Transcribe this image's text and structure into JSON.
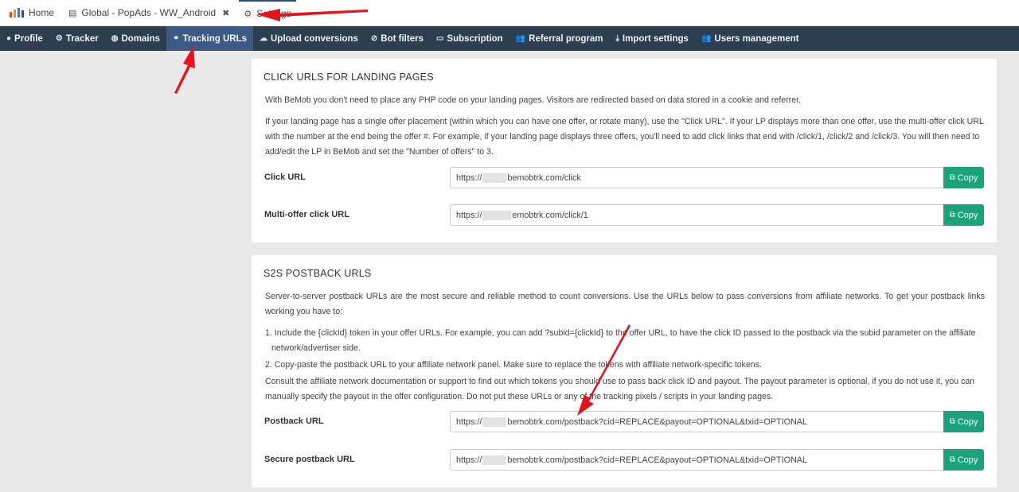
{
  "topbar": {
    "tabs": [
      {
        "label": "Home"
      },
      {
        "label": "Global - PopAds - WW_Android"
      },
      {
        "label": "Settings"
      }
    ]
  },
  "nav": {
    "items": [
      {
        "label": "Profile",
        "icon": "user-icon"
      },
      {
        "label": "Tracker",
        "icon": "gear-icon"
      },
      {
        "label": "Domains",
        "icon": "globe-icon"
      },
      {
        "label": "Tracking URLs",
        "icon": "link-icon",
        "active": true
      },
      {
        "label": "Upload conversions",
        "icon": "cloud-upload-icon"
      },
      {
        "label": "Bot filters",
        "icon": "ban-icon"
      },
      {
        "label": "Subscription",
        "icon": "card-icon"
      },
      {
        "label": "Referral program",
        "icon": "users-icon"
      },
      {
        "label": "Import settings",
        "icon": "download-icon"
      },
      {
        "label": "Users management",
        "icon": "users-icon"
      }
    ]
  },
  "click_panel": {
    "title": "CLICK URLS FOR LANDING PAGES",
    "p1": "With BeMob you don't need to place any PHP code on your landing pages. Visitors are redirected based on data stored in a cookie and referrer.",
    "p2": "If your landing page has a single offer placement (within which you can have one offer, or rotate many), use the \"Click URL\". If your LP displays more than one offer, use the multi-offer click URL with the number at the end being the offer #. For example, if your landing page displays three offers, you'll need to add click links that end with /click/1, /click/2 and /click/3. You will then need to add/edit the LP in BeMob and set the \"Number of offers\" to 3.",
    "click_url_label": "Click URL",
    "click_url_prefix": "https://",
    "click_url_suffix": "bemobtrk.com/click",
    "multi_url_label": "Multi-offer click URL",
    "multi_url_prefix": "https://",
    "multi_url_suffix": "emobtrk.com/click/1",
    "copy_label": "Copy"
  },
  "postback_panel": {
    "title": "S2S POSTBACK URLS",
    "p1": "Server-to-server postback URLs are the most secure and reliable method to count conversions. Use the URLs below to pass conversions from affiliate networks. To get your postback links working you have to:",
    "step1": "1. Include the {clickId} token in your offer URLs. For example, you can add ?subid={clickId} to the offer URL, to have the click ID passed to the postback via the subid parameter on the affiliate network/advertiser side.",
    "step2": "2. Copy-paste the postback URL to your affiliate network panel. Make sure to replace the tokens with affiliate network-specific tokens.",
    "p2": "Consult the affiliate network documentation or support to find out which tokens you should use to pass back click ID and payout. The payout parameter is optional, if you do not use it, you can manually specify the payout in the offer configuration. Do not put these URLs or any of the tracking pixels / scripts in your landing pages.",
    "postback_label": "Postback URL",
    "postback_prefix": "https://",
    "postback_suffix": "bemobtrk.com/postback?cid=REPLACE&payout=OPTIONAL&txid=OPTIONAL",
    "secure_label": "Secure postback URL",
    "secure_prefix": "https://",
    "secure_suffix": "bemobtrk.com/postback?cid=REPLACE&payout=OPTIONAL&txid=OPTIONAL",
    "copy_label": "Copy"
  },
  "colors": {
    "navbar": "#2c3e4f",
    "nav_active": "#3b5a86",
    "copy_button": "#1aa27b",
    "annotation_arrow": "#e8121b"
  }
}
